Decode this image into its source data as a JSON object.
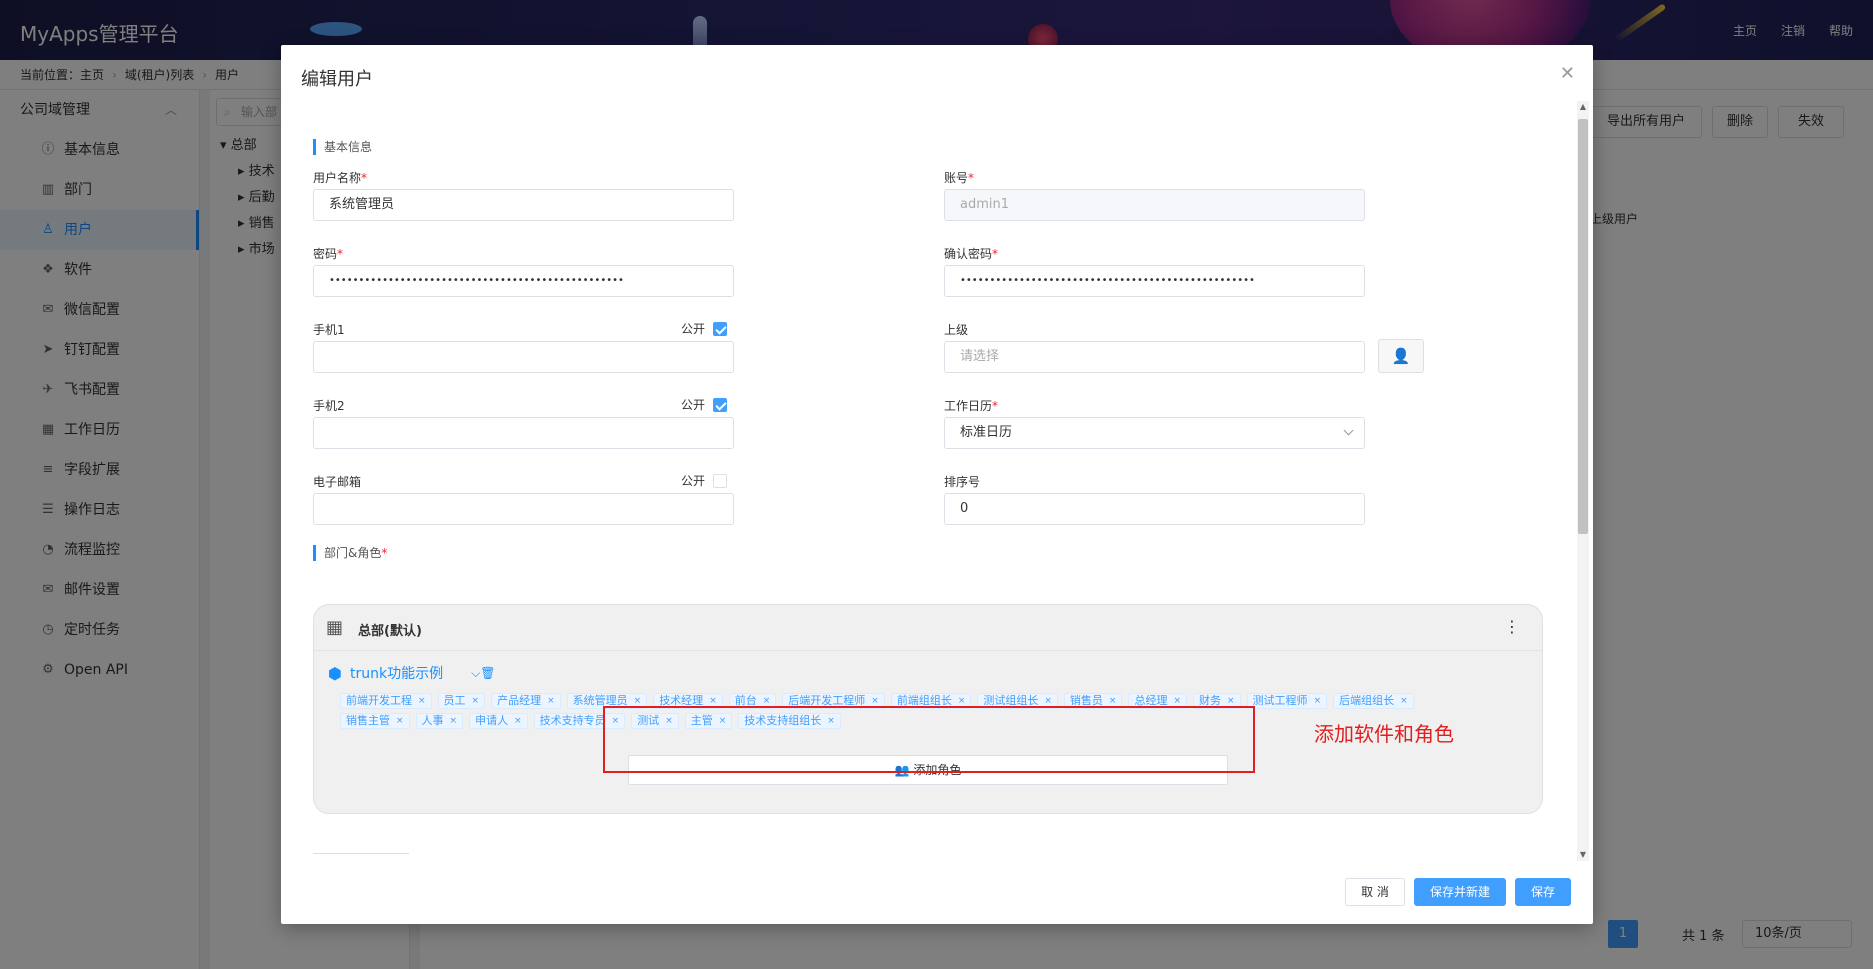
{
  "app": {
    "title": "MyApps管理平台"
  },
  "topnav": [
    "主页",
    "注销",
    "帮助"
  ],
  "breadcrumb": {
    "prefix": "当前位置：",
    "items": [
      "主页",
      "域(租户)列表",
      "用户"
    ]
  },
  "sidebar": {
    "group": "公司域管理",
    "items": [
      {
        "label": "基本信息",
        "icon": "info-icon",
        "glyph": "ⓘ"
      },
      {
        "label": "部门",
        "icon": "building-icon",
        "glyph": "▥"
      },
      {
        "label": "用户",
        "icon": "user-icon",
        "glyph": "♙"
      },
      {
        "label": "软件",
        "icon": "cubes-icon",
        "glyph": "❖"
      },
      {
        "label": "微信配置",
        "icon": "wechat-icon",
        "glyph": "✉"
      },
      {
        "label": "钉钉配置",
        "icon": "dingtalk-icon",
        "glyph": "➤"
      },
      {
        "label": "飞书配置",
        "icon": "feishu-icon",
        "glyph": "✈"
      },
      {
        "label": "工作日历",
        "icon": "calendar-icon",
        "glyph": "▦"
      },
      {
        "label": "字段扩展",
        "icon": "sliders-icon",
        "glyph": "≡"
      },
      {
        "label": "操作日志",
        "icon": "log-icon",
        "glyph": "☰"
      },
      {
        "label": "流程监控",
        "icon": "dashboard-icon",
        "glyph": "◔"
      },
      {
        "label": "邮件设置",
        "icon": "envelope-icon",
        "glyph": "✉"
      },
      {
        "label": "定时任务",
        "icon": "clock-icon",
        "glyph": "◷"
      },
      {
        "label": "Open API",
        "icon": "api-icon",
        "glyph": "⚙"
      }
    ]
  },
  "tree": {
    "search_placeholder": "输入部",
    "root": "总部",
    "children": [
      "技术",
      "后勤",
      "销售",
      "市场"
    ]
  },
  "main": {
    "buttons": [
      "导出所有用户",
      "删除",
      "失效"
    ],
    "column_partial": "上级用户",
    "pager": {
      "current": "1",
      "total": "共 1 条",
      "size": "10条/页"
    }
  },
  "modal": {
    "title": "编辑用户",
    "section_basic": "基本信息",
    "section_dept": "部门&角色",
    "fields": {
      "username": {
        "label": "用户名称",
        "value": "系统管理员"
      },
      "account": {
        "label": "账号",
        "value": "admin1"
      },
      "password": {
        "label": "密码",
        "value": "••••••••••••••••••••••••••••••••••••••••••••••••••"
      },
      "confirm": {
        "label": "确认密码",
        "value": "••••••••••••••••••••••••••••••••••••••••••••••••••"
      },
      "mobile1": {
        "label": "手机1",
        "value": "",
        "public_label": "公开",
        "public": true
      },
      "superior": {
        "label": "上级",
        "placeholder": "请选择"
      },
      "mobile2": {
        "label": "手机2",
        "value": "",
        "public_label": "公开",
        "public": true
      },
      "calendar": {
        "label": "工作日历",
        "value": "标准日历"
      },
      "email": {
        "label": "电子邮箱",
        "value": "",
        "public_label": "公开",
        "public": false
      },
      "order": {
        "label": "排序号",
        "value": "0"
      }
    },
    "dept": {
      "name": "总部(默认)",
      "app_name": "trunk功能示例",
      "roles_row1": [
        "前端开发工程",
        "员工",
        "产品经理",
        "系统管理员",
        "技术经理",
        "前台",
        "后端开发工程师",
        "前端组组长",
        "测试组组长",
        "销售员",
        "总经理",
        "财务",
        "测试工程师",
        "后端组组长"
      ],
      "roles_row2": [
        "销售主管",
        "人事",
        "申请人",
        "技术支持专员",
        "测试",
        "主管",
        "技术支持组组长"
      ],
      "add_role_label": "添加角色"
    },
    "annotation": "添加软件和角色",
    "footer": {
      "cancel": "取 消",
      "save_new": "保存并新建",
      "save": "保存"
    }
  },
  "colors": {
    "primary": "#409eff",
    "required": "#f5222d",
    "annotation": "#e02020"
  }
}
